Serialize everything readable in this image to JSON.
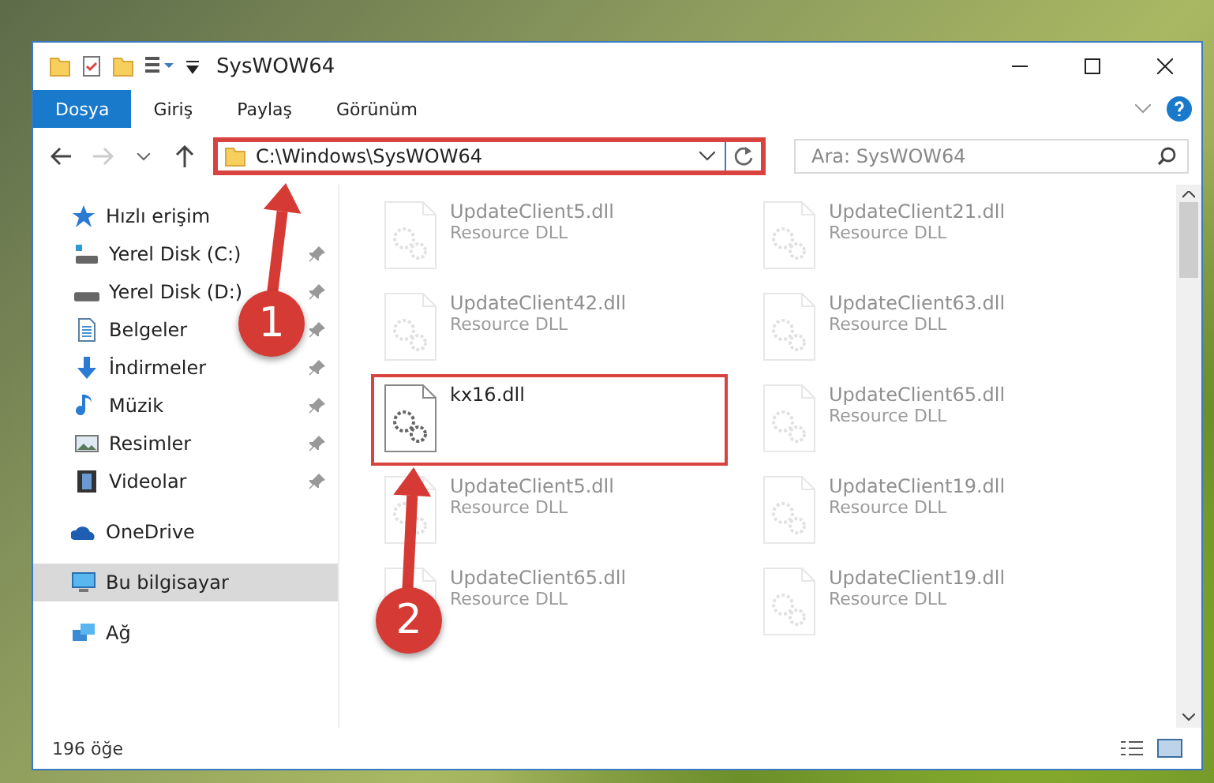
{
  "window": {
    "title": "SysWOW64"
  },
  "ribbon": {
    "tabs": [
      {
        "label": "Dosya",
        "selected": true
      },
      {
        "label": "Giriş",
        "selected": false
      },
      {
        "label": "Paylaş",
        "selected": false
      },
      {
        "label": "Görünüm",
        "selected": false
      }
    ]
  },
  "address_bar": {
    "path": "C:\\Windows\\SysWOW64",
    "highlighted": true
  },
  "search": {
    "placeholder": "Ara: SysWOW64"
  },
  "sidebar": {
    "items": [
      {
        "label": "Hızlı erişim",
        "kind": "star",
        "selected": false,
        "children": [
          {
            "label": "Yerel Disk (C:)",
            "kind": "system-drive",
            "pinned": true
          },
          {
            "label": "Yerel Disk (D:)",
            "kind": "drive",
            "pinned": true
          },
          {
            "label": "Belgeler",
            "kind": "documents",
            "pinned": true
          },
          {
            "label": "İndirmeler",
            "kind": "downloads",
            "pinned": true
          },
          {
            "label": "Müzik",
            "kind": "music",
            "pinned": true
          },
          {
            "label": "Resimler",
            "kind": "pictures",
            "pinned": true
          },
          {
            "label": "Videolar",
            "kind": "videos",
            "pinned": true
          }
        ]
      },
      {
        "label": "OneDrive",
        "kind": "cloud",
        "selected": false
      },
      {
        "label": "Bu bilgisayar",
        "kind": "computer",
        "selected": true
      },
      {
        "label": "Ağ",
        "kind": "network",
        "selected": false
      }
    ]
  },
  "files": [
    {
      "name": "UpdateClient5.dll",
      "type": "Resource DLL",
      "dimmed": true,
      "highlighted": false
    },
    {
      "name": "UpdateClient21.dll",
      "type": "Resource DLL",
      "dimmed": true,
      "highlighted": false
    },
    {
      "name": "UpdateClient42.dll",
      "type": "Resource DLL",
      "dimmed": true,
      "highlighted": false
    },
    {
      "name": "UpdateClient63.dll",
      "type": "Resource DLL",
      "dimmed": true,
      "highlighted": false
    },
    {
      "name": "kx16.dll",
      "dimmed": false,
      "highlighted": true
    },
    {
      "name": "UpdateClient65.dll",
      "type": "Resource DLL",
      "dimmed": true,
      "highlighted": false
    },
    {
      "name": "UpdateClient5.dll",
      "type": "Resource DLL",
      "dimmed": true,
      "highlighted": false
    },
    {
      "name": "UpdateClient19.dll",
      "type": "Resource DLL",
      "dimmed": true,
      "highlighted": false
    },
    {
      "name": "UpdateClient65.dll",
      "type": "Resource DLL",
      "dimmed": true,
      "highlighted": false
    },
    {
      "name": "UpdateClient19.dll",
      "type": "Resource DLL",
      "dimmed": true,
      "highlighted": false
    }
  ],
  "status_bar": {
    "item_count": "196 öğe"
  },
  "annotations": [
    {
      "number": "1"
    },
    {
      "number": "2"
    }
  ]
}
